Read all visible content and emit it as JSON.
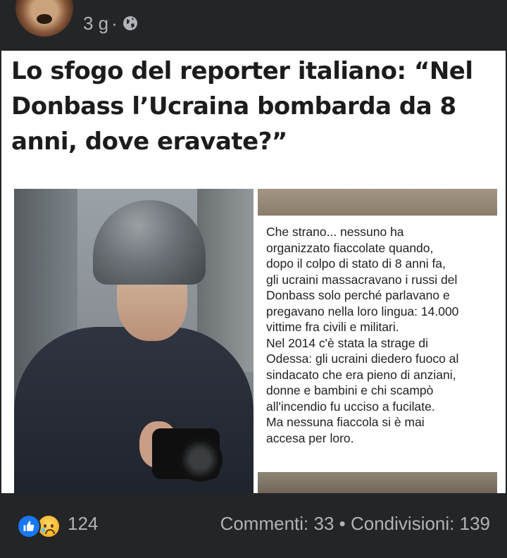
{
  "post": {
    "time": "3 g",
    "separator": "·",
    "audience_icon": "globe-icon"
  },
  "card": {
    "headline": "Lo sfogo del reporter italiano: “Nel Donbass l’Ucraina bombarda da 8 anni, dove eravate?”",
    "quote": "Che strano... nessuno ha\norganizzato fiaccolate quando,\ndopo il colpo di stato di 8 anni fa,\ngli ucraini massacravano i russi del\nDonbass solo perché parlavano e\npregavano nella loro lingua: 14.000\nvittime fra civili e militari.\nNel 2014 c'è stata la strage di\nOdessa: gli ucraini diedero fuoco al\nsindacato che era pieno di anziani,\ndonne e bambini e chi scampò\nall'incendio fu ucciso a fucilate.\nMa nessuna fiaccola si è mai\naccesa per loro."
  },
  "reactions": {
    "icons": [
      "like-icon",
      "sad-icon"
    ],
    "count": "124",
    "comments": "Commenti: 33",
    "dot": "•",
    "shares": "Condivisioni: 139"
  },
  "colors": {
    "background": "#242526",
    "meta_text": "#b0b3b8",
    "like_blue": "#1877f2"
  }
}
